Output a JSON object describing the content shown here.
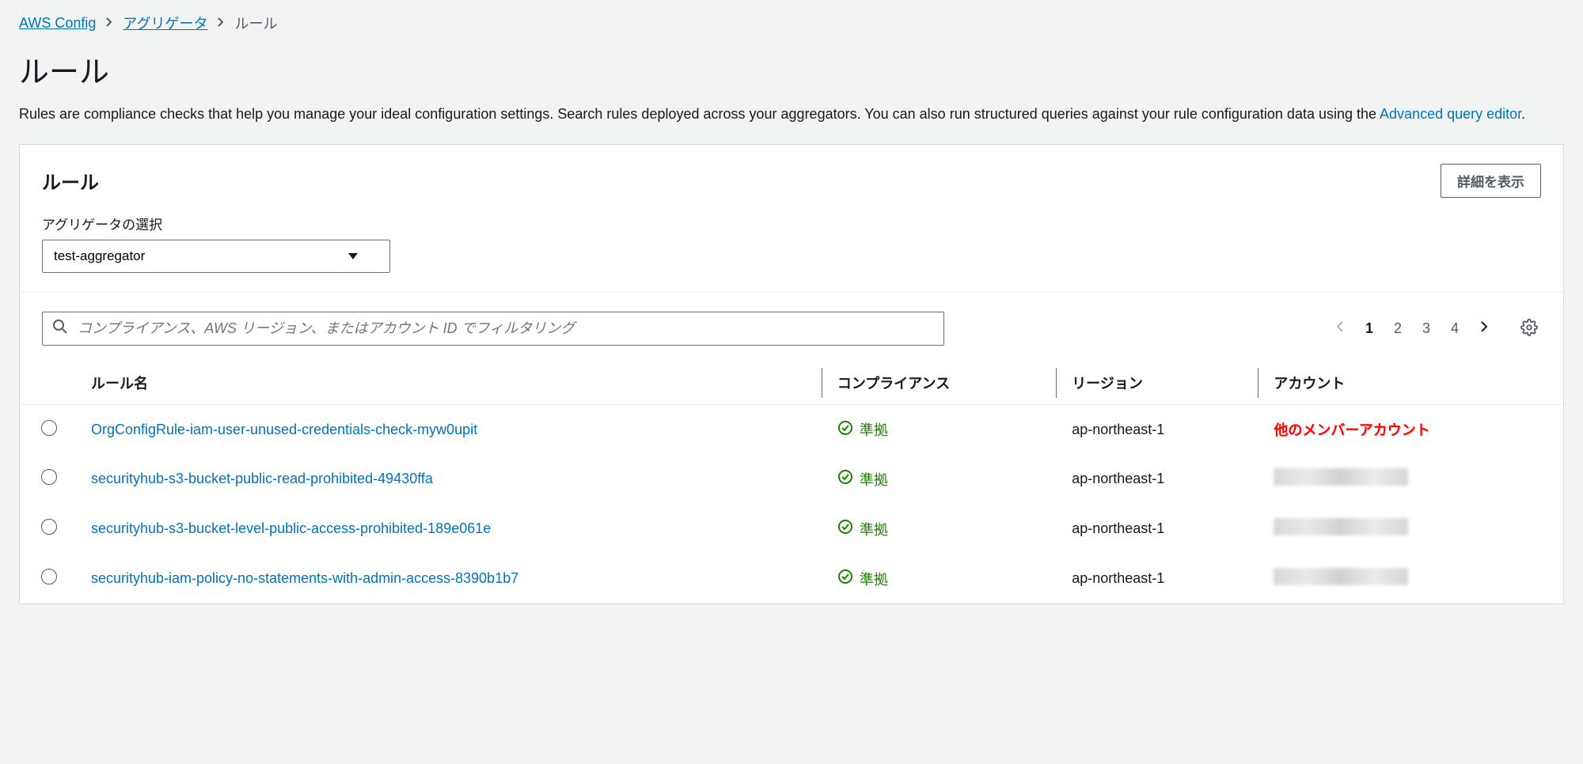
{
  "breadcrumb": {
    "root": "AWS Config",
    "mid": "アグリゲータ",
    "current": "ルール"
  },
  "page": {
    "title": "ルール",
    "desc_prefix": "Rules are compliance checks that help you manage your ideal configuration settings. Search rules deployed across your aggregators. You can also run structured queries against your rule configuration data using the ",
    "desc_link": "Advanced query editor",
    "desc_suffix": "."
  },
  "panel": {
    "title": "ルール",
    "details_button": "詳細を表示"
  },
  "filter": {
    "label": "アグリゲータの選択",
    "selected": "test-aggregator"
  },
  "search": {
    "placeholder": "コンプライアンス、AWS リージョン、またはアカウント ID でフィルタリング"
  },
  "pagination": {
    "pages": [
      "1",
      "2",
      "3",
      "4"
    ],
    "current": "1"
  },
  "table": {
    "headers": {
      "rule_name": "ルール名",
      "compliance": "コンプライアンス",
      "region": "リージョン",
      "account": "アカウント"
    },
    "compliant_label": "準拠",
    "rows": [
      {
        "rule": "OrgConfigRule-iam-user-unused-credentials-check-myw0upit",
        "region": "ap-northeast-1",
        "account_display": "他のメンバーアカウント",
        "account_kind": "label"
      },
      {
        "rule": "securityhub-s3-bucket-public-read-prohibited-49430ffa",
        "region": "ap-northeast-1",
        "account_kind": "blurred"
      },
      {
        "rule": "securityhub-s3-bucket-level-public-access-prohibited-189e061e",
        "region": "ap-northeast-1",
        "account_kind": "blurred"
      },
      {
        "rule": "securityhub-iam-policy-no-statements-with-admin-access-8390b1b7",
        "region": "ap-northeast-1",
        "account_kind": "blurred"
      }
    ]
  }
}
